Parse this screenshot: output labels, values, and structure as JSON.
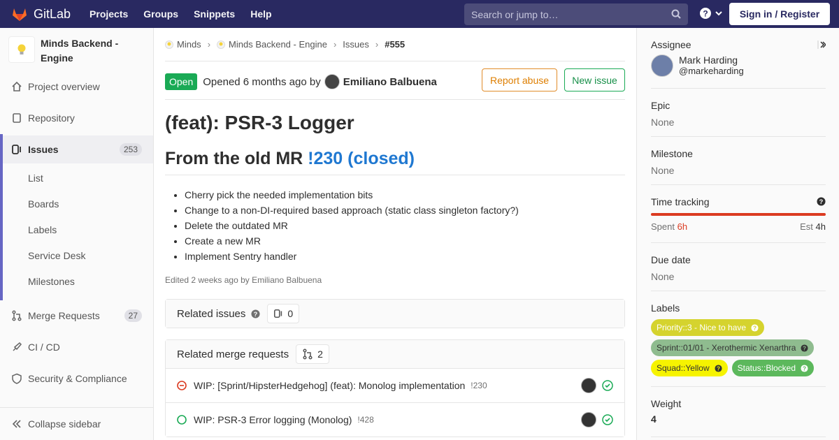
{
  "navbar": {
    "brand": "GitLab",
    "links": [
      "Projects",
      "Groups",
      "Snippets",
      "Help"
    ],
    "search_placeholder": "Search or jump to…",
    "signin": "Sign in / Register"
  },
  "sidebar": {
    "project_name": "Minds Backend - Engine",
    "items": [
      {
        "label": "Project overview",
        "icon": "home-icon"
      },
      {
        "label": "Repository",
        "icon": "doc-icon"
      },
      {
        "label": "Issues",
        "icon": "issues-icon",
        "count": "253"
      },
      {
        "label": "Merge Requests",
        "icon": "merge-request-icon",
        "count": "27"
      },
      {
        "label": "CI / CD",
        "icon": "rocket-icon"
      },
      {
        "label": "Security & Compliance",
        "icon": "shield-icon"
      }
    ],
    "sub_items": [
      "List",
      "Boards",
      "Labels",
      "Service Desk",
      "Milestones"
    ],
    "collapse": "Collapse sidebar"
  },
  "breadcrumb": [
    "Minds",
    "Minds Backend - Engine",
    "Issues",
    "#555"
  ],
  "issue": {
    "status": "Open",
    "opened_text": "Opened 6 months ago by",
    "author": "Emiliano Balbuena",
    "report_abuse": "Report abuse",
    "new_issue": "New issue",
    "title": "(feat): PSR-3 Logger",
    "h2_prefix": "From the old MR",
    "h2_link": "!230 (closed)",
    "bullets": [
      "Cherry pick the needed implementation bits",
      "Change to a non-DI-required based approach (static class singleton factory?)",
      "Delete the outdated MR",
      "Create a new MR",
      "Implement Sentry handler"
    ],
    "edited": "Edited 2 weeks ago by Emiliano Balbuena"
  },
  "related_issues": {
    "label": "Related issues",
    "count": "0"
  },
  "related_mrs": {
    "label": "Related merge requests",
    "count": "2",
    "items": [
      {
        "title": "WIP: [Sprint/HipsterHedgehog] (feat): Monolog implementation",
        "ref": "!230",
        "state": "closed"
      },
      {
        "title": "WIP: PSR-3 Error logging (Monolog)",
        "ref": "!428",
        "state": "open"
      }
    ]
  },
  "right": {
    "assignee_label": "Assignee",
    "assignee_name": "Mark Harding",
    "assignee_handle": "@markeharding",
    "epic_label": "Epic",
    "epic_value": "None",
    "milestone_label": "Milestone",
    "milestone_value": "None",
    "time_label": "Time tracking",
    "spent_label": "Spent",
    "spent_value": "6h",
    "est_label": "Est",
    "est_value": "4h",
    "due_label": "Due date",
    "due_value": "None",
    "labels_label": "Labels",
    "labels": [
      {
        "text": "Priority::3 - Nice to have",
        "bg": "#d5d32e",
        "fg": "#ffffff"
      },
      {
        "text": "Sprint::01/01 - Xerothermic Xenarthra",
        "bg": "#8fbc8f",
        "fg": "#333333"
      },
      {
        "text": "Squad::Yellow",
        "bg": "#f6f300",
        "fg": "#333333"
      },
      {
        "text": "Status::Blocked",
        "bg": "#5cb85c",
        "fg": "#ffffff"
      }
    ],
    "weight_label": "Weight",
    "weight_value": "4"
  },
  "colors": {
    "navbar": "#292961",
    "accent": "#6666c4",
    "open": "#1aaa55",
    "link": "#1f78d1"
  }
}
